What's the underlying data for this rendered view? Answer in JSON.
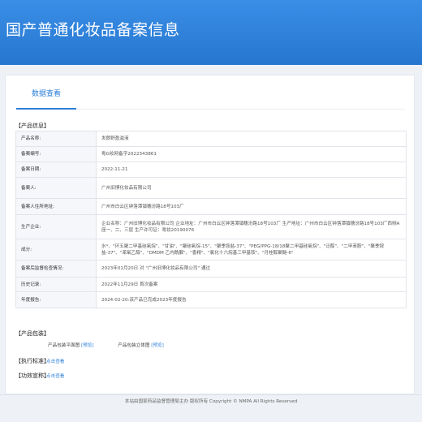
{
  "header": {
    "title": "国产普通化妆品备案信息"
  },
  "tabs": [
    {
      "label": "数据查看"
    }
  ],
  "product_info": {
    "section_title": "【产品信息】",
    "rows": [
      {
        "key": "产品名称:",
        "value": "发朗舒盈滋液"
      },
      {
        "key": "备案编号:",
        "value": "粤G妆网备字2022343861"
      },
      {
        "key": "备案日期:",
        "value": "2022-11-21"
      },
      {
        "key": "备案人:",
        "value": "广州旧博化妆品有限公司"
      },
      {
        "key": "备案人住所地址:",
        "value": "广州市白云区钟落潭镇穗汾路18号103厂"
      },
      {
        "key": "生产企业:",
        "value": "企业名称：广州旧博化妆品有限公司 企业地址：广州市白云区钟落潭镇穗汾路18号103厂 生产地址：广州市白云区钟落潭镇穗汾路18号103厂西侧A座一、二、三层 生产许可证：粤妆20190076"
      },
      {
        "key": "成分:",
        "value": "水*、\"环五聚二甲基硅氧烷\"、\"甘油\"、\"聚硅氧烷-15\"、\"聚季铵盐-37\"、\"PEG/PPG-18/18聚二甲基硅氧烷\"、\"泛醇\"、\"二甲苯胺\"、\"聚季铵盐-37\"、\"苯氧乙醇\"、\"DMDM 乙内酰脲\"、\"香精\"、\"氯化十六烷基三甲基铵\"、\"月桂醇聚醚-6\""
      },
      {
        "key": "备案后监督检查情况:",
        "value": "2023年01月20日 对 \"广州旧博化妆品有限公司\" 通过"
      },
      {
        "key": "历史记录:",
        "value": "2022年11月29日 首次备案"
      },
      {
        "key": "年度报告:",
        "value": "2024-02-20:该产品已完成2023年度报告"
      }
    ]
  },
  "packaging": {
    "section_title": "【产品包装】",
    "items": [
      {
        "label": "产品包装平面图",
        "link": "[预览]"
      },
      {
        "label": "产品包装立体图",
        "link": "[预览]"
      }
    ]
  },
  "standard": {
    "section_title": "【执行标准】",
    "link": "点击查看"
  },
  "efficacy": {
    "section_title": "【功效宣称】",
    "link": "点击查看"
  },
  "footer": {
    "text": "本站由国家药品监督管理局主办 版权所有 Copyright © NMPA All Rights Reserved"
  }
}
